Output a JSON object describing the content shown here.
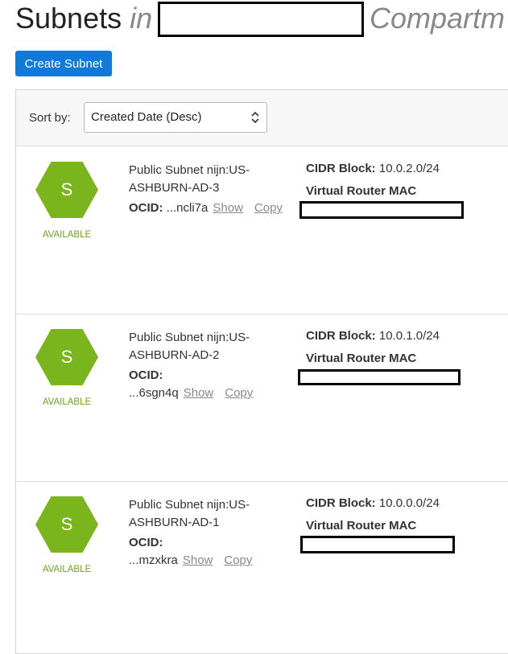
{
  "header": {
    "title": "Subnets",
    "in_word": "in",
    "compartment_word": "Compartm"
  },
  "toolbar": {
    "create_label": "Create Subnet",
    "sort_label": "Sort by:",
    "sort_value": "Created Date (Desc)"
  },
  "subnets": [
    {
      "icon_letter": "S",
      "status": "AVAILABLE",
      "name": "Public Subnet nijn:US-ASHBURN-AD-3",
      "ocid_label": "OCID:",
      "ocid_suffix": "...ncli7a",
      "show_label": "Show",
      "copy_label": "Copy",
      "cidr_label": "CIDR Block:",
      "cidr_value": "10.0.2.0/24",
      "mac_label": "Virtual Router MAC"
    },
    {
      "icon_letter": "S",
      "status": "AVAILABLE",
      "name": "Public Subnet nijn:US-ASHBURN-AD-2",
      "ocid_label": "OCID:",
      "ocid_suffix": "...6sgn4q",
      "show_label": "Show",
      "copy_label": "Copy",
      "cidr_label": "CIDR Block:",
      "cidr_value": "10.0.1.0/24",
      "mac_label": "Virtual Router MAC"
    },
    {
      "icon_letter": "S",
      "status": "AVAILABLE",
      "name": "Public Subnet nijn:US-ASHBURN-AD-1",
      "ocid_label": "OCID:",
      "ocid_suffix": "...mzxkra",
      "show_label": "Show",
      "copy_label": "Copy",
      "cidr_label": "CIDR Block:",
      "cidr_value": "10.0.0.0/24",
      "mac_label": "Virtual Router MAC"
    }
  ],
  "colors": {
    "accent": "#1379d6",
    "status_green": "#6ea31c",
    "hex_green": "#7ab51d"
  }
}
